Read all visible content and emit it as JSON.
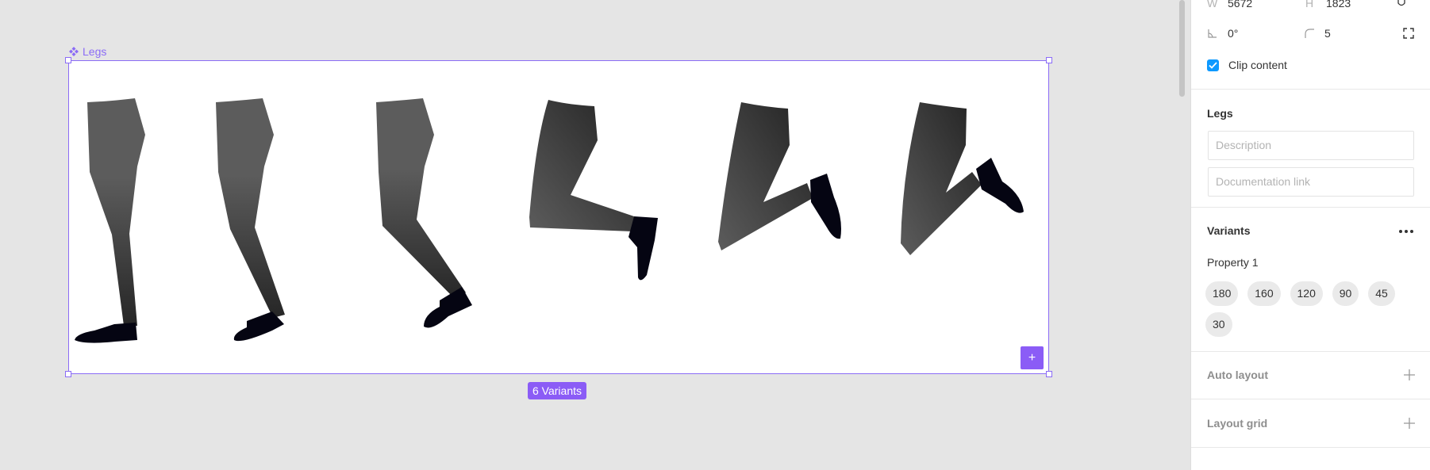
{
  "canvas": {
    "frame_name": "Legs",
    "variant_badge": "6 Variants",
    "add_variant_symbol": "+",
    "leg_variants": [
      "180",
      "160",
      "120",
      "90",
      "45",
      "30"
    ]
  },
  "panel": {
    "dimensions": {
      "w_label": "W",
      "w_value": "5672",
      "h_label": "H",
      "h_value": "1823"
    },
    "rotation": "0°",
    "radius": "5",
    "clip_content": {
      "label": "Clip content",
      "checked": true
    },
    "component": {
      "title": "Legs",
      "description_placeholder": "Description",
      "doc_link_placeholder": "Documentation link"
    },
    "variants": {
      "title": "Variants",
      "more_symbol": "...",
      "property_name": "Property 1",
      "values": [
        "180",
        "160",
        "120",
        "90",
        "45",
        "30"
      ]
    },
    "auto_layout": "Auto layout",
    "layout_grid": "Layout grid"
  },
  "colors": {
    "accent": "#8b5cf6",
    "checkbox": "#0d99ff",
    "pant_light": "#5c5c5c",
    "pant_dark": "#262626",
    "shoe": "#050512"
  }
}
